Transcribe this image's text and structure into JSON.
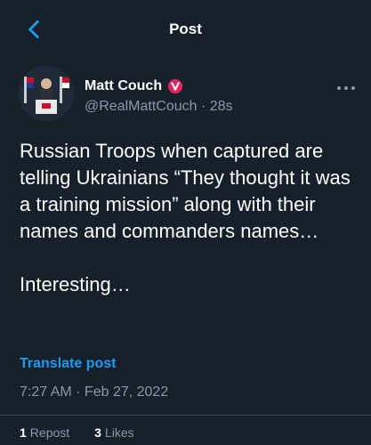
{
  "header": {
    "title": "Post"
  },
  "author": {
    "name": "Matt Couch",
    "handle": "@RealMattCouch",
    "separator": "·",
    "age": "28s"
  },
  "post": {
    "text": "Russian Troops when captured are telling Ukrainians “They thought it was a training mission” along with their names and commanders names…\n\nInteresting…",
    "translate_label": "Translate post",
    "timestamp": "7:27 AM · Feb 27, 2022"
  },
  "stats": {
    "reposts_count": "1",
    "reposts_label": "Repost",
    "likes_count": "3",
    "likes_label": "Likes"
  },
  "colors": {
    "background": "#15202b",
    "accent": "#1d9bf0",
    "secondary_text": "#8b98a5",
    "verified_badge": "#e0245e"
  }
}
